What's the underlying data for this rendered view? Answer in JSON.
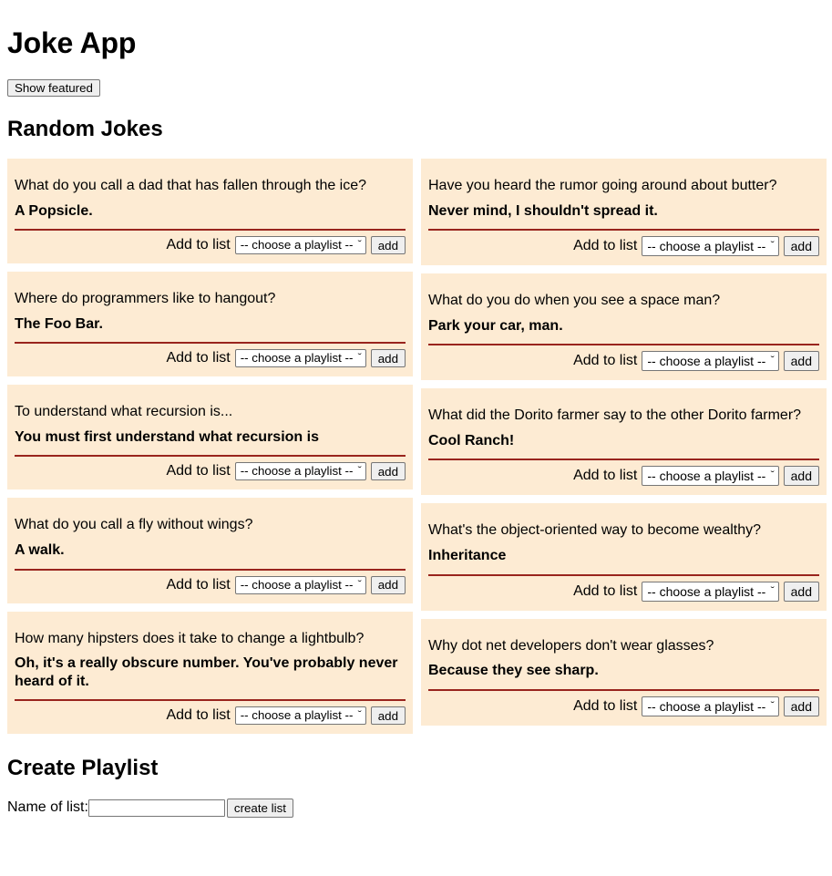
{
  "app": {
    "title": "Joke App",
    "featured_button_label": "Show featured"
  },
  "random_jokes": {
    "heading": "Random Jokes",
    "add_label": "Add to list",
    "select_placeholder": "-- choose a playlist --",
    "add_button_label": "add",
    "chevron_icon": "ˇ",
    "card_bg": "#fdebd3",
    "rule_color": "#99241d",
    "left_column": [
      {
        "question": "What do you call a dad that has fallen through the ice?",
        "answer": "A Popsicle."
      },
      {
        "question": "Where do programmers like to hangout?",
        "answer": "The Foo Bar."
      },
      {
        "question": "To understand what recursion is...",
        "answer": "You must first understand what recursion is"
      },
      {
        "question": "What do you call a fly without wings?",
        "answer": "A walk."
      },
      {
        "question": "How many hipsters does it take to change a lightbulb?",
        "answer": "Oh, it's a really obscure number. You've probably never heard of it."
      }
    ],
    "right_column": [
      {
        "question": "Have you heard the rumor going around about butter?",
        "answer": "Never mind, I shouldn't spread it."
      },
      {
        "question": "What do you do when you see a space man?",
        "answer": "Park your car, man."
      },
      {
        "question": "What did the Dorito farmer say to the other Dorito farmer?",
        "answer": "Cool Ranch!"
      },
      {
        "question": "What's the object-oriented way to become wealthy?",
        "answer": "Inheritance"
      },
      {
        "question": "Why dot net developers don't wear glasses?",
        "answer": "Because they see sharp."
      }
    ]
  },
  "create_playlist": {
    "heading": "Create Playlist",
    "name_label": "Name of list:",
    "name_value": "",
    "name_placeholder": "",
    "create_button_label": "create list"
  }
}
